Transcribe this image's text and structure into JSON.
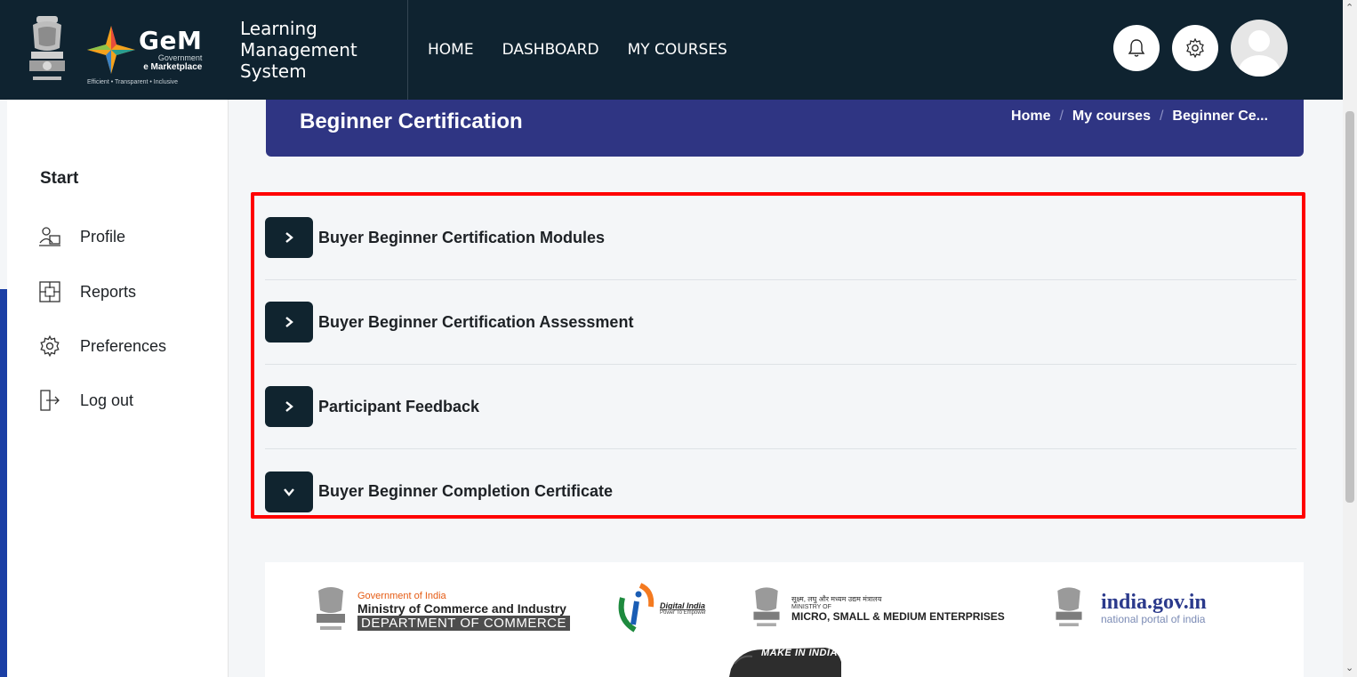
{
  "header": {
    "gem_word": "GeM",
    "gem_sub1": "Government",
    "gem_sub2": "e Marketplace",
    "gem_tagline": "Efficient • Transparent • Inclusive",
    "lms_title": "Learning Management System",
    "nav": [
      "HOME",
      "DASHBOARD",
      "MY COURSES"
    ]
  },
  "sidebar": {
    "heading": "Start",
    "items": [
      {
        "label": "Profile",
        "icon": "profile-icon"
      },
      {
        "label": "Reports",
        "icon": "reports-icon"
      },
      {
        "label": "Preferences",
        "icon": "gear-icon"
      },
      {
        "label": "Log out",
        "icon": "logout-icon"
      }
    ]
  },
  "page": {
    "title": "Beginner Certification",
    "breadcrumb": [
      "Home",
      "My courses",
      "Beginner Ce..."
    ],
    "breadcrumb_sep": "/"
  },
  "sections": [
    {
      "title": "Buyer Beginner Certification Modules",
      "expanded": false
    },
    {
      "title": "Buyer Beginner Certification Assessment",
      "expanded": false
    },
    {
      "title": "Participant Feedback",
      "expanded": false
    },
    {
      "title": "Buyer Beginner Completion Certificate",
      "expanded": true
    }
  ],
  "footer": {
    "commerce": {
      "goi": "Government of India",
      "ministry": "Ministry of Commerce and Industry",
      "dept": "DEPARTMENT OF COMMERCE"
    },
    "digital_india": {
      "title": "Digital India",
      "tagline": "Power To Empower"
    },
    "msme": {
      "hindi": "सूक्ष्म, लघु और मध्यम उद्यम मंत्रालय",
      "ministry_of": "MINISTRY OF",
      "name": "MICRO, SMALL & MEDIUM ENTERPRISES"
    },
    "india_gov": {
      "main": "india.gov.in",
      "sub": "national portal of india"
    },
    "make_in_india": "MAKE IN INDIA"
  },
  "colors": {
    "navbar": "#0f2330",
    "page_header": "#2f3583",
    "highlight": "#ff0000",
    "toggle": "#10242f"
  }
}
